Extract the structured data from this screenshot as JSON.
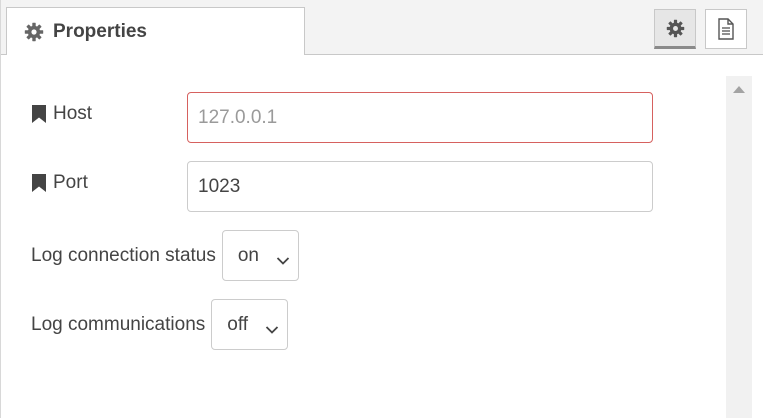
{
  "header": {
    "tab_label": "Properties",
    "tab_icon": "gear-icon",
    "buttons": [
      {
        "icon": "gear-icon",
        "active": true
      },
      {
        "icon": "document-icon",
        "active": false
      }
    ]
  },
  "form": {
    "host": {
      "label": "Host",
      "value": "",
      "placeholder": "127.0.0.1",
      "invalid": true
    },
    "port": {
      "label": "Port",
      "value": "1023"
    },
    "log_connection_status": {
      "label": "Log connection status",
      "selected": "on"
    },
    "log_communications": {
      "label": "Log communications",
      "selected": "off"
    }
  },
  "colors": {
    "invalid_border": "#d6615f",
    "text": "#444444",
    "header_bg": "#f3f3f3"
  }
}
